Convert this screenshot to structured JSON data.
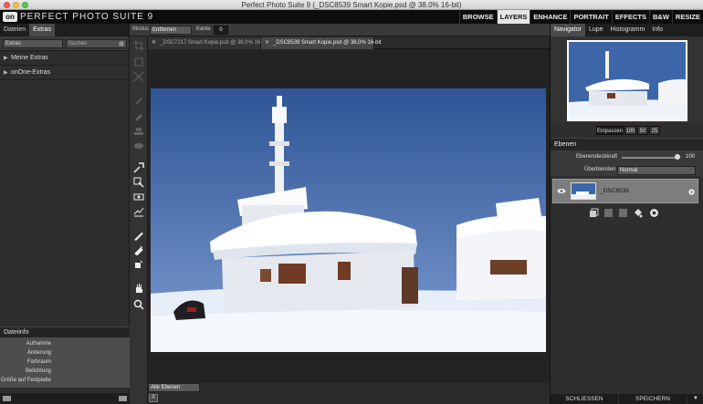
{
  "window": {
    "title": "Perfect Photo Suite 9 (_DSC8539 Smart Kopie.psd @ 38.0% 16-bit)"
  },
  "header": {
    "logo": "on",
    "app_name": "PERFECT PHOTO SUITE 9",
    "modules": [
      {
        "label": "BROWSE",
        "active": false
      },
      {
        "label": "LAYERS",
        "active": true
      },
      {
        "label": "ENHANCE",
        "active": false
      },
      {
        "label": "PORTRAIT",
        "active": false
      },
      {
        "label": "EFFECTS",
        "active": false
      },
      {
        "label": "B&W",
        "active": false
      },
      {
        "label": "RESIZE",
        "active": false
      }
    ]
  },
  "left_panel": {
    "tabs": [
      {
        "label": "Dateien"
      },
      {
        "label": "Extras"
      }
    ],
    "filter_value": "Extras",
    "search_placeholder": "Suchen",
    "items": [
      {
        "label": "Meine Extras"
      },
      {
        "label": "onOne-Extras"
      }
    ],
    "fileinfo": {
      "title": "Dateiinfo",
      "rows": [
        "Aufnahme",
        "Änderung",
        "Farbraum",
        "Belichtung",
        "Größe auf Festplatte"
      ]
    }
  },
  "options": {
    "modus_label": "Modus",
    "modus_value": "Entfernen",
    "kante_label": "Kante",
    "kante_value": "0"
  },
  "documents": [
    {
      "label": "_DSC7217 Smart Kopie.psd @ 38,0% 16-bit",
      "active": false
    },
    {
      "label": "_DSC8539 Smart Kopie.psd @ 38,0% 16-bit",
      "active": true
    }
  ],
  "canvas": {
    "layers_filter": "Alle Ebenen",
    "icon_letter": "A"
  },
  "right_panel": {
    "tabs": [
      {
        "label": "Navigator"
      },
      {
        "label": "Lupe"
      },
      {
        "label": "Histogramm"
      },
      {
        "label": "Info"
      }
    ],
    "zoom": {
      "fit_label": "Einpassen",
      "levels": [
        "100",
        "50",
        "25"
      ]
    },
    "layers": {
      "title": "Ebenen",
      "opacity_label": "Ebenendeckkraft",
      "opacity_value": "100",
      "blend_label": "Überblenden",
      "blend_value": "Normal",
      "items": [
        {
          "name": "_DSC8539"
        }
      ]
    },
    "bottom": {
      "close_label": "SCHLIESSEN",
      "save_label": "SPEICHERN"
    }
  },
  "colors": {
    "accent_active": "#e6e6e6",
    "sky": "#3d66a8",
    "panel": "#2e2e2e"
  }
}
